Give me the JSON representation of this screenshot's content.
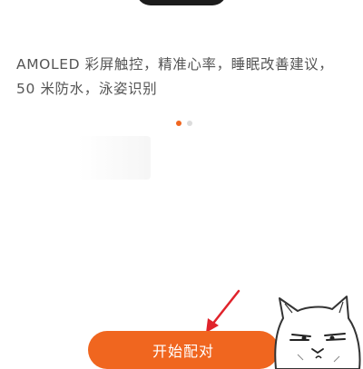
{
  "device": {
    "description": "AMOLED 彩屏触控，精准心率，睡眠改善建议，50 米防水，泳姿识别"
  },
  "carousel": {
    "page_count": 2,
    "active_index": 0
  },
  "action": {
    "start_pairing_label": "开始配对"
  },
  "colors": {
    "accent": "#f0661f",
    "arrow": "#e0232b",
    "dot_inactive": "#dcdcdc"
  }
}
